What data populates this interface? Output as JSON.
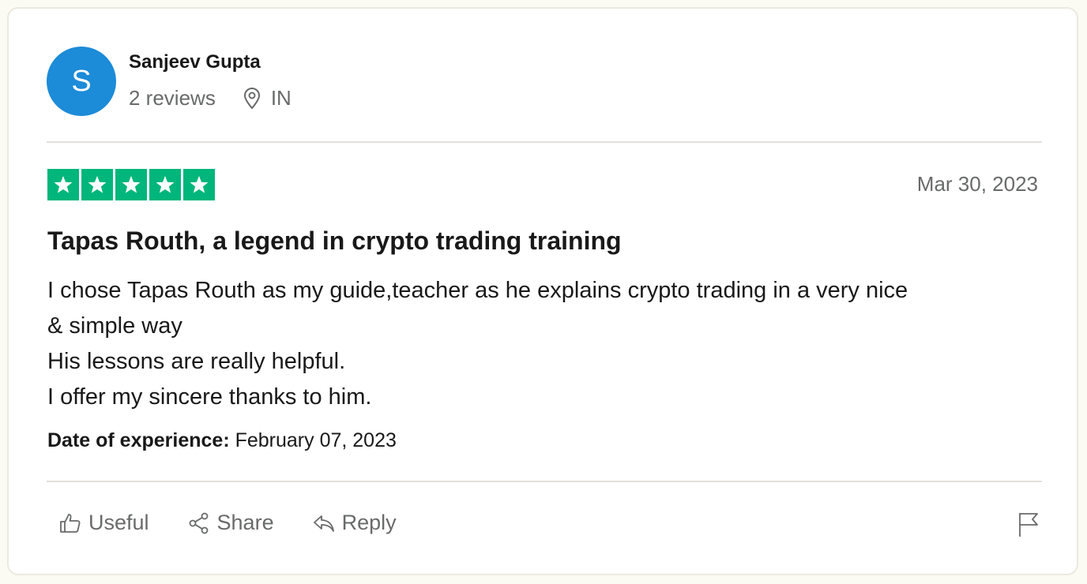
{
  "reviewer": {
    "initial": "S",
    "name": "Sanjeev Gupta",
    "reviews": "2 reviews",
    "country": "IN",
    "avatar_color": "#1c8bd8"
  },
  "review": {
    "rating": 5,
    "max_rating": 5,
    "star_color": "#00b67a",
    "date": "Mar 30, 2023",
    "title": "Tapas Routh, a legend in crypto trading training",
    "body_lines": [
      "I chose Tapas Routh as my guide,teacher as he explains crypto trading in a very nice",
      "& simple way",
      "His lessons are really helpful.",
      "I offer my sincere thanks to him."
    ],
    "experience_label": "Date of experience:",
    "experience_date": "February 07, 2023"
  },
  "actions": {
    "useful": "Useful",
    "share": "Share",
    "reply": "Reply"
  },
  "icons": {
    "location": "location-pin-icon",
    "useful": "thumbs-up-icon",
    "share": "share-icon",
    "reply": "reply-icon",
    "flag": "flag-icon"
  }
}
